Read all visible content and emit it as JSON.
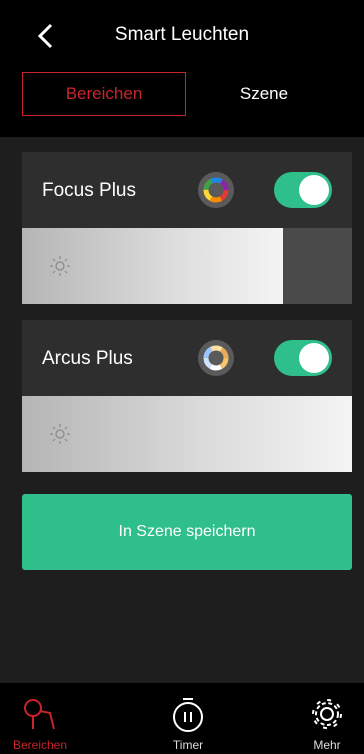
{
  "header": {
    "title": "Smart Leuchten",
    "back_icon": "chevron-left-icon"
  },
  "segment": {
    "left_label": "Bereichen",
    "right_label": "Szene",
    "selected": "Bereichen",
    "accent": "#c8242a"
  },
  "lights": [
    {
      "name": "Focus Plus",
      "on": true,
      "brightness": 0.79,
      "color_icon": "color-wheel-icon"
    },
    {
      "name": "Arcus Plus",
      "on": true,
      "brightness": 1.0,
      "color_icon": "color-wheel-icon"
    }
  ],
  "save_button": {
    "label": "In Szene speichern",
    "color": "#2fbf8b"
  },
  "tabbar": {
    "items": [
      {
        "label": "Bereichen",
        "icon": "lamp-icon",
        "active": true
      },
      {
        "label": "Timer",
        "icon": "timer-icon",
        "active": false
      },
      {
        "label": "Mehr",
        "icon": "gear-icon",
        "active": false
      }
    ]
  }
}
